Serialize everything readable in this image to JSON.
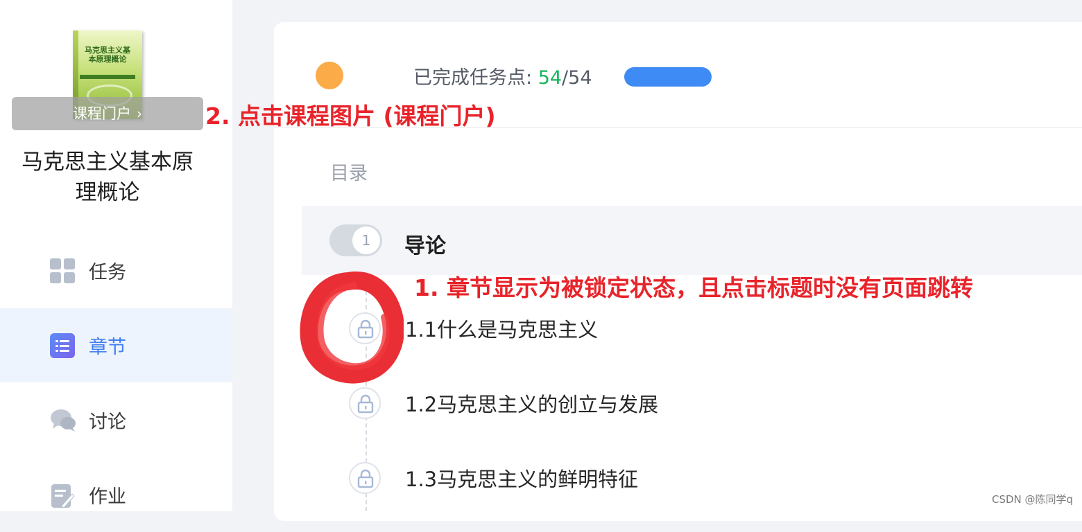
{
  "sidebar": {
    "cover": {
      "book_title": "马克思主义基本原理概论",
      "portal_label": "课程门户",
      "portal_chevron": "›"
    },
    "course_title": "马克思主义基本原理概论",
    "nav": [
      {
        "label": "任务",
        "icon": "grid-icon",
        "active": false
      },
      {
        "label": "章节",
        "icon": "list-icon",
        "active": true
      },
      {
        "label": "讨论",
        "icon": "chat-bubbles-icon",
        "active": false
      },
      {
        "label": "作业",
        "icon": "edit-note-icon",
        "active": false
      }
    ]
  },
  "header": {
    "progress_label": "已完成任务点: ",
    "done": "54",
    "separator": "/",
    "total": "54",
    "status_dot_color": "#fbab48",
    "progress_fill": 1.0,
    "accent": "#3f8bf5"
  },
  "toc": {
    "label": "目录",
    "chapter": {
      "number": "1",
      "title": "导论"
    },
    "sections": [
      {
        "title": "1.1什么是马克思主义",
        "locked": true
      },
      {
        "title": "1.2马克思主义的创立与发展",
        "locked": true
      },
      {
        "title": "1.3马克思主义的鲜明特征",
        "locked": true
      }
    ]
  },
  "annotations": {
    "note_1": "1. 章节显示为被锁定状态，且点击标题时没有页面跳转",
    "note_2": "2. 点击课程图片 (课程门户)",
    "color": "#e8232a"
  },
  "watermark": "CSDN @陈同学q"
}
